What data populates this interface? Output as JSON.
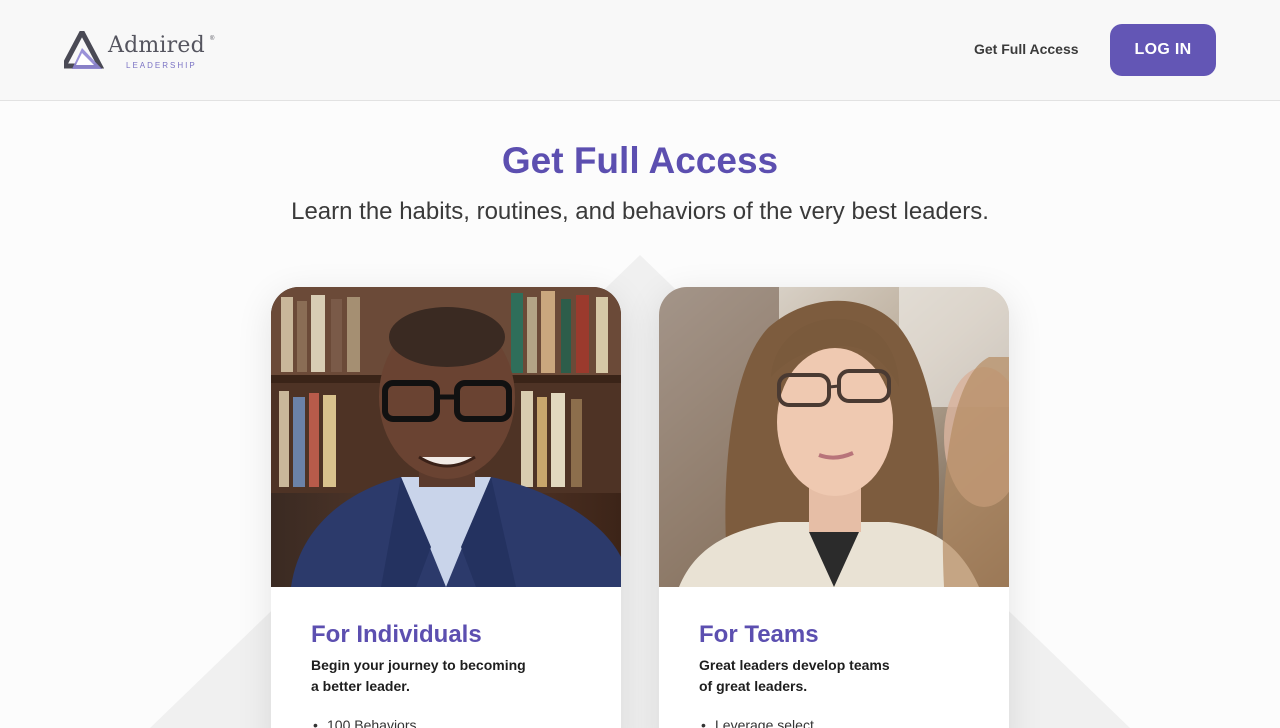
{
  "header": {
    "logo": {
      "word": "Admired",
      "reg": "®",
      "sub": "LEADERSHIP"
    },
    "nav_link": "Get Full Access",
    "login_label": "LOG IN"
  },
  "hero": {
    "title": "Get Full Access",
    "subtitle": "Learn the habits, routines, and behaviors of the very best leaders."
  },
  "cards": [
    {
      "title": "For Individuals",
      "desc_line1": "Begin your journey to becoming",
      "desc_line2": "a better leader.",
      "list": [
        "100 Behaviors"
      ]
    },
    {
      "title": "For Teams",
      "desc_line1": "Great leaders develop teams",
      "desc_line2": "of great leaders.",
      "list": [
        "Leverage select..."
      ]
    }
  ],
  "colors": {
    "brand": "#6356b5",
    "brand_text": "#5c4fb0",
    "header_bg": "#f8f8f8"
  }
}
